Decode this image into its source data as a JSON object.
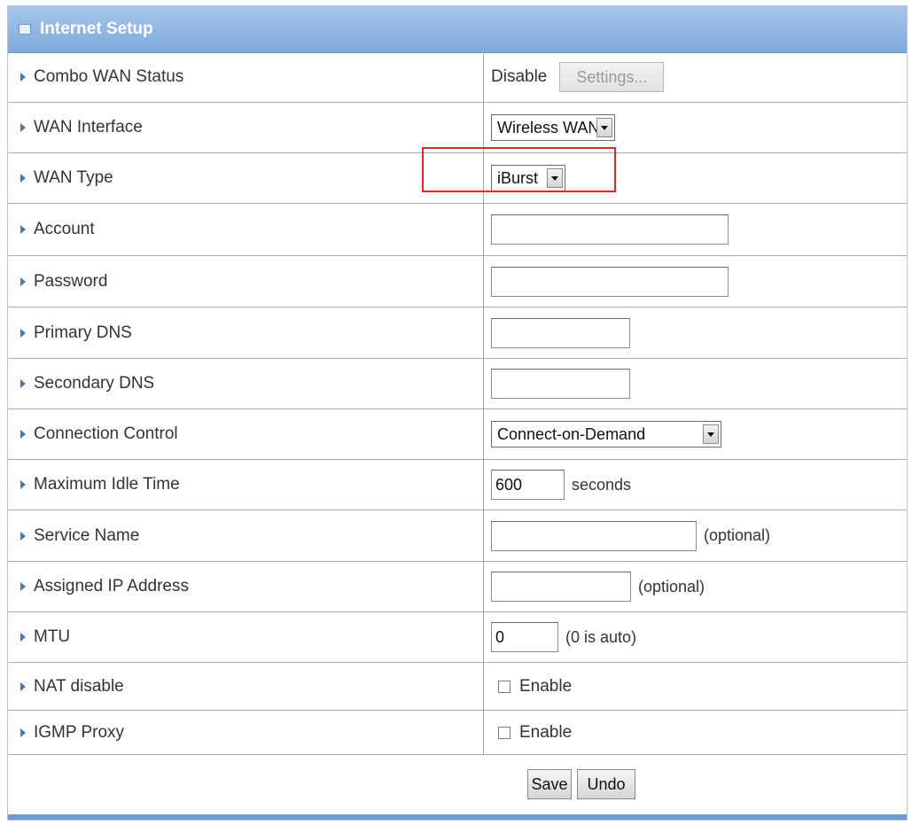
{
  "header": {
    "title": "Internet Setup"
  },
  "rows": {
    "combo_wan_status": {
      "label": "Combo WAN Status",
      "value": "Disable",
      "button": "Settings..."
    },
    "wan_interface": {
      "label": "WAN Interface",
      "selected": "Wireless WAN"
    },
    "wan_type": {
      "label": "WAN Type",
      "selected": "iBurst"
    },
    "account": {
      "label": "Account",
      "value": ""
    },
    "password": {
      "label": "Password",
      "value": ""
    },
    "primary_dns": {
      "label": "Primary DNS",
      "value": ""
    },
    "secondary_dns": {
      "label": "Secondary DNS",
      "value": ""
    },
    "connection_control": {
      "label": "Connection Control",
      "selected": "Connect-on-Demand"
    },
    "max_idle_time": {
      "label": "Maximum Idle Time",
      "value": "600",
      "suffix": "seconds"
    },
    "service_name": {
      "label": "Service Name",
      "value": "",
      "suffix": "(optional)"
    },
    "assigned_ip": {
      "label": "Assigned IP Address",
      "value": "",
      "suffix": "(optional)"
    },
    "mtu": {
      "label": "MTU",
      "value": "0",
      "suffix": "(0 is auto)"
    },
    "nat_disable": {
      "label": "NAT disable",
      "checkbox_label": "Enable",
      "checked": false
    },
    "igmp_proxy": {
      "label": "IGMP Proxy",
      "checkbox_label": "Enable",
      "checked": false
    }
  },
  "actions": {
    "save": "Save",
    "undo": "Undo"
  },
  "colors": {
    "header_blue": "#7fa8da",
    "highlight_red": "#d62a2a"
  }
}
